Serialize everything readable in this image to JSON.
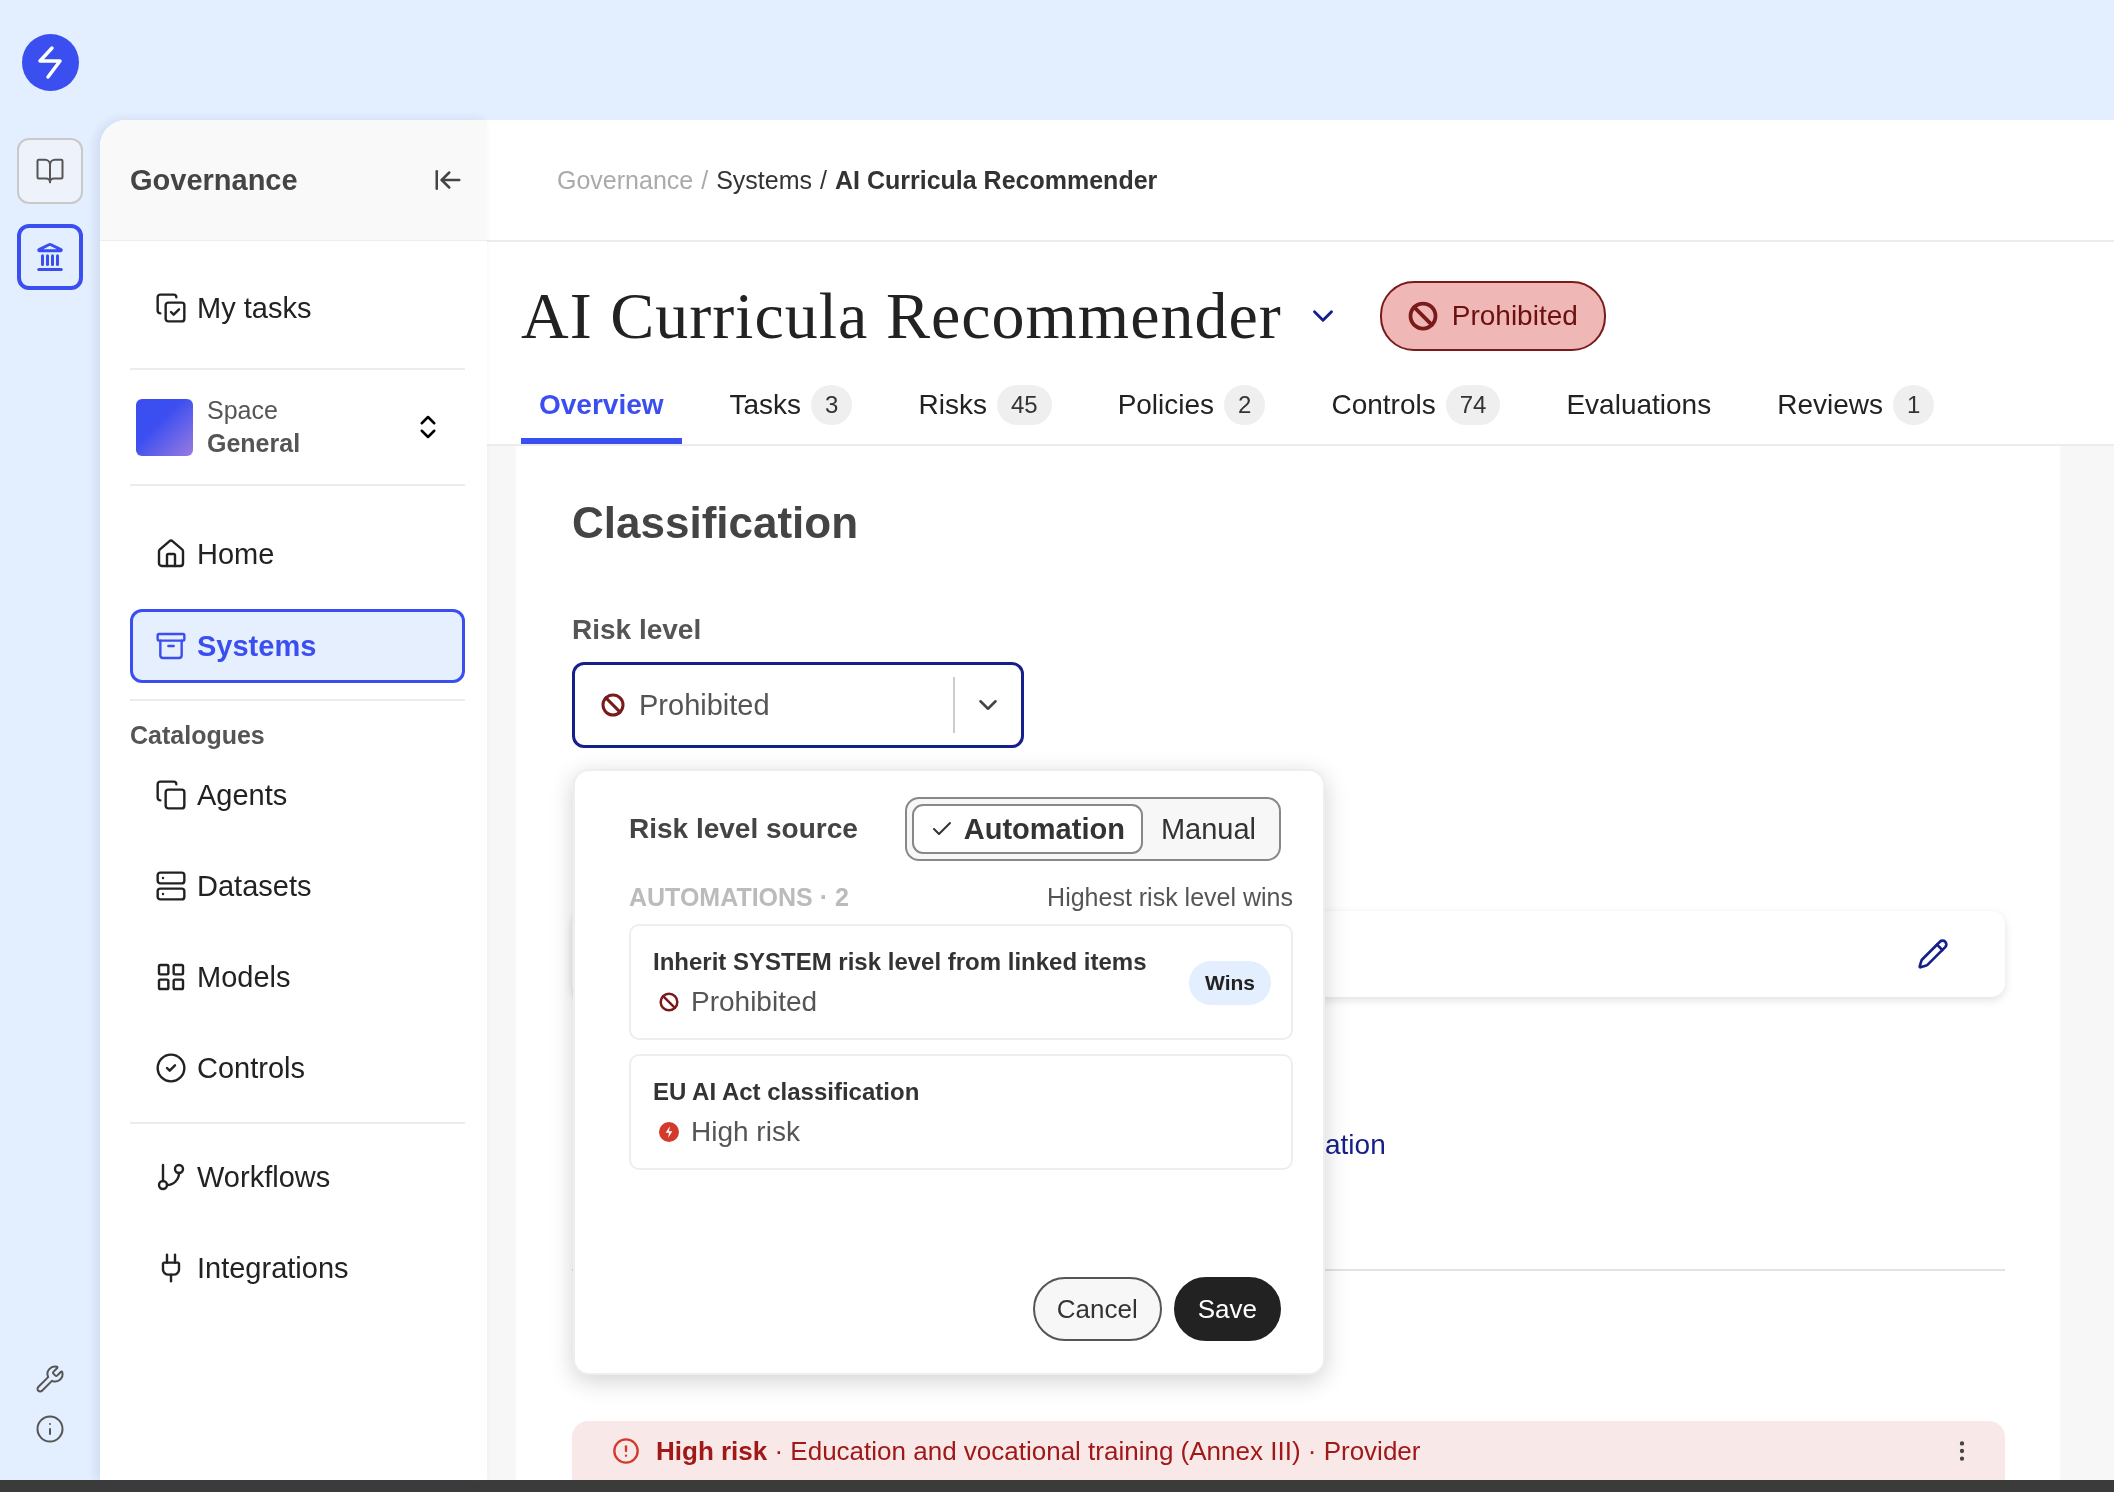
{
  "rail": {
    "items": [
      {
        "selected": false
      },
      {
        "selected": true
      }
    ]
  },
  "sidebar": {
    "title": "Governance",
    "my_tasks": {
      "label": "My tasks",
      "selected": false
    },
    "space": {
      "caption": "Space",
      "name": "General"
    },
    "primary": [
      {
        "label": "Home",
        "selected": false
      },
      {
        "label": "Systems",
        "selected": true
      }
    ],
    "catalogues": {
      "heading": "Catalogues",
      "items": [
        {
          "label": "Agents",
          "selected": false
        },
        {
          "label": "Datasets",
          "selected": false
        },
        {
          "label": "Models",
          "selected": false
        },
        {
          "label": "Controls",
          "selected": false
        }
      ]
    },
    "more": [
      {
        "label": "Workflows",
        "selected": false
      },
      {
        "label": "Integrations",
        "selected": false
      }
    ]
  },
  "header": {
    "separator": "/",
    "breadcrumb": [
      {
        "label": "Governance",
        "kind": "muted"
      },
      {
        "label": "Systems",
        "kind": "link"
      },
      {
        "label": "AI Curricula Recommender",
        "kind": "current"
      }
    ],
    "title": "AI Curricula Recommender",
    "status": {
      "label": "Prohibited",
      "kind": "prohibited"
    },
    "tabs": [
      {
        "label": "Overview",
        "selected": true
      },
      {
        "label": "Tasks",
        "count": "3",
        "selected": false
      },
      {
        "label": "Risks",
        "count": "45",
        "selected": false
      },
      {
        "label": "Policies",
        "count": "2",
        "selected": false
      },
      {
        "label": "Controls",
        "count": "74",
        "selected": false
      },
      {
        "label": "Evaluations",
        "selected": false
      },
      {
        "label": "Reviews",
        "count": "1",
        "selected": false
      }
    ]
  },
  "classification": {
    "heading": "Classification",
    "risk_label": "Risk level",
    "risk": {
      "label": "Prohibited",
      "kind": "prohibited"
    },
    "link_fragment": "ation",
    "alert": {
      "text": "**High risk** · Education and vocational training (Annex III) · Provider"
    }
  },
  "popup": {
    "title": "Risk level source",
    "options": [
      {
        "label": "Automation",
        "selected": true
      },
      {
        "label": "Manual",
        "selected": false
      }
    ],
    "list_caption": "AUTOMATIONS · 2",
    "rule": "Highest risk level wins",
    "automations": [
      {
        "name": "Inherit SYSTEM risk level from linked items",
        "result": "Prohibited",
        "kind": "prohibited",
        "badge": "Wins"
      },
      {
        "name": "EU AI Act classification",
        "result": "High risk",
        "kind": "high"
      }
    ],
    "buttons": [
      {
        "label": "Cancel",
        "kind": "secondary"
      },
      {
        "label": "Save",
        "kind": "primary"
      }
    ]
  }
}
